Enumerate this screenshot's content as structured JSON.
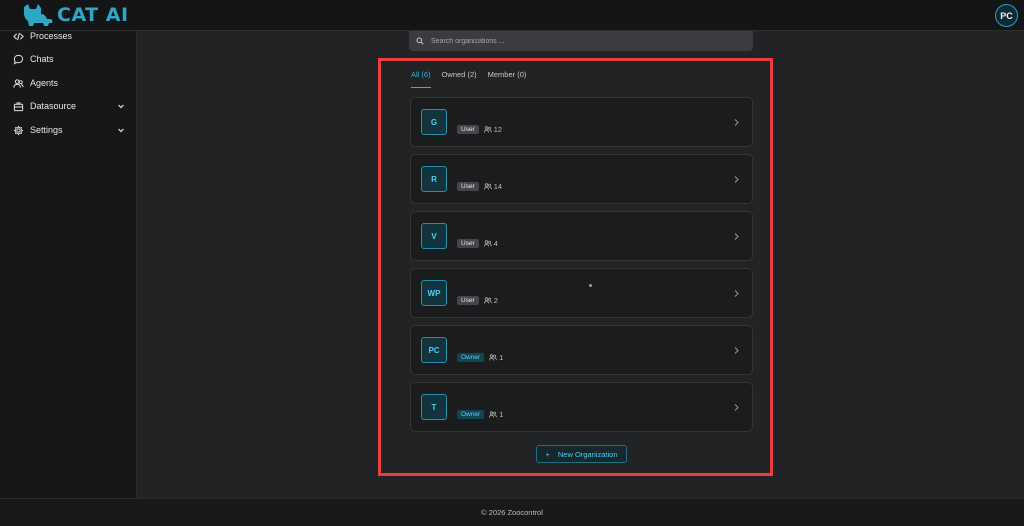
{
  "app": {
    "name": "CAT AI",
    "user_initials": "PC"
  },
  "sidebar": {
    "items": [
      {
        "label": "Processes",
        "icon": "code-icon"
      },
      {
        "label": "Chats",
        "icon": "chat-bubble-icon"
      },
      {
        "label": "Agents",
        "icon": "users-icon"
      },
      {
        "label": "Datasource",
        "icon": "briefcase-icon",
        "expandable": true
      },
      {
        "label": "Settings",
        "icon": "gear-icon",
        "expandable": true
      }
    ]
  },
  "search": {
    "placeholder": "Search organizations ..."
  },
  "tabs": [
    {
      "label": "All (6)",
      "active": true
    },
    {
      "label": "Owned (2)",
      "active": false
    },
    {
      "label": "Member (0)",
      "active": false
    }
  ],
  "organizations": [
    {
      "initials": "G",
      "role": "User",
      "members": "12"
    },
    {
      "initials": "R",
      "role": "User",
      "members": "14"
    },
    {
      "initials": "V",
      "role": "User",
      "members": "4"
    },
    {
      "initials": "WP",
      "role": "User",
      "members": "2"
    },
    {
      "initials": "PC",
      "role": "Owner",
      "members": "1"
    },
    {
      "initials": "T",
      "role": "Owner",
      "members": "1"
    }
  ],
  "new_org_label": "New Organization",
  "new_org_icon": "+",
  "footer": {
    "text": "© 2026  Zoocontrol"
  },
  "colors": {
    "accent": "#2eb6d8",
    "highlight_border": "#e8403f",
    "background": "#222325"
  }
}
